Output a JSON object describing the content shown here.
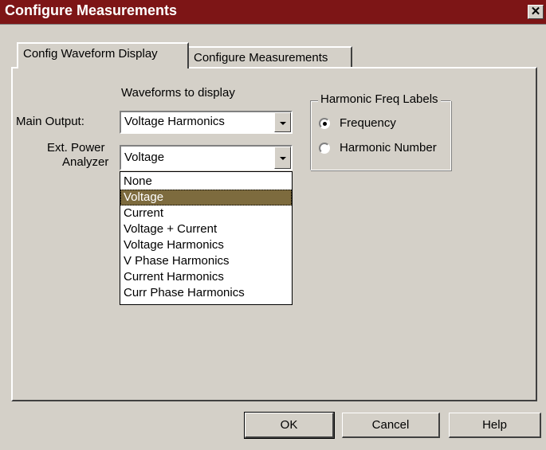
{
  "window": {
    "title": "Configure Measurements",
    "close_glyph": "✕"
  },
  "tabs": [
    {
      "label": "Config Waveform Display",
      "active": true
    },
    {
      "label": "Configure Measurements",
      "active": false
    }
  ],
  "waveforms": {
    "heading": "Waveforms to display",
    "main_output_label": "Main Output:",
    "main_output_value": "Voltage Harmonics",
    "ext_label_line1": "Ext. Power",
    "ext_label_line2": "Analyzer",
    "ext_value": "Voltage",
    "options": [
      "None",
      "Voltage",
      "Current",
      "Voltage + Current",
      "Voltage Harmonics",
      "V Phase Harmonics",
      "Current Harmonics",
      "Curr Phase Harmonics"
    ],
    "selected_option": "Voltage"
  },
  "harmonic_labels": {
    "title": "Harmonic Freq Labels",
    "options": [
      {
        "label": "Frequency",
        "checked": true
      },
      {
        "label": "Harmonic Number",
        "checked": false
      }
    ]
  },
  "buttons": {
    "ok": "OK",
    "cancel": "Cancel",
    "help": "Help"
  },
  "icons": {
    "close": "close-icon",
    "dropdown": "chevron-down-icon"
  }
}
